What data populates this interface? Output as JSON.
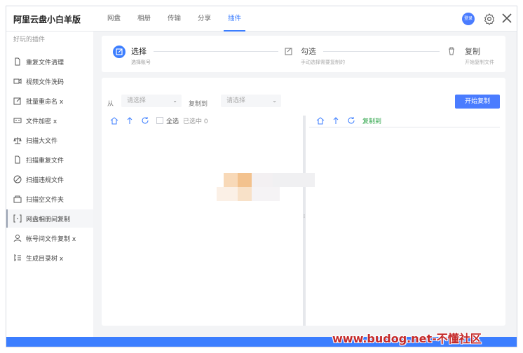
{
  "app": {
    "title": "阿里云盘小白羊版"
  },
  "header": {
    "tabs": [
      {
        "label": "网盘"
      },
      {
        "label": "相册"
      },
      {
        "label": "传输"
      },
      {
        "label": "分享"
      },
      {
        "label": "插件",
        "active": true
      }
    ],
    "login_label": "登录",
    "accent_color": "#3c7eff"
  },
  "sidebar": {
    "heading": "好玩的插件",
    "items": [
      {
        "label": "重复文件清理",
        "icon": "file-icon"
      },
      {
        "label": "视频文件洗码",
        "icon": "video-icon"
      },
      {
        "label": "批量重命名 x",
        "icon": "edit-icon"
      },
      {
        "label": "文件加密 x",
        "icon": "encrypt-icon"
      },
      {
        "label": "扫描大文件",
        "icon": "scale-icon"
      },
      {
        "label": "扫描重复文件",
        "icon": "duplicate-icon"
      },
      {
        "label": "扫描违规文件",
        "icon": "forbidden-icon"
      },
      {
        "label": "扫描空文件夹",
        "icon": "empty-folder-icon"
      },
      {
        "label": "网盘相册间复制",
        "icon": "copy-between-icon",
        "active": true
      },
      {
        "label": "帐号间文件复制 x",
        "icon": "accounts-icon"
      },
      {
        "label": "生成目录树 x",
        "icon": "tree-icon"
      }
    ]
  },
  "steps": [
    {
      "title": "选择",
      "desc": "选择账号",
      "icon": "edit-icon"
    },
    {
      "title": "勾选",
      "desc": "手动选择需要复制的",
      "icon": "checkbox-edit-icon"
    },
    {
      "title": "复制",
      "desc": "开始复制文件",
      "icon": "trash-icon"
    }
  ],
  "toolbar": {
    "from_label": "从",
    "from_placeholder": "请选择",
    "copy_to_label": "复制到",
    "to_placeholder": "请选择",
    "start_button": "开始复制"
  },
  "left_pane": {
    "select_all": "全选",
    "selected_count": "已选中 0"
  },
  "right_pane": {
    "copy_to": "复制到"
  },
  "watermark": {
    "text_a": "www.budog.net",
    "text_b": "-不懂社区"
  }
}
